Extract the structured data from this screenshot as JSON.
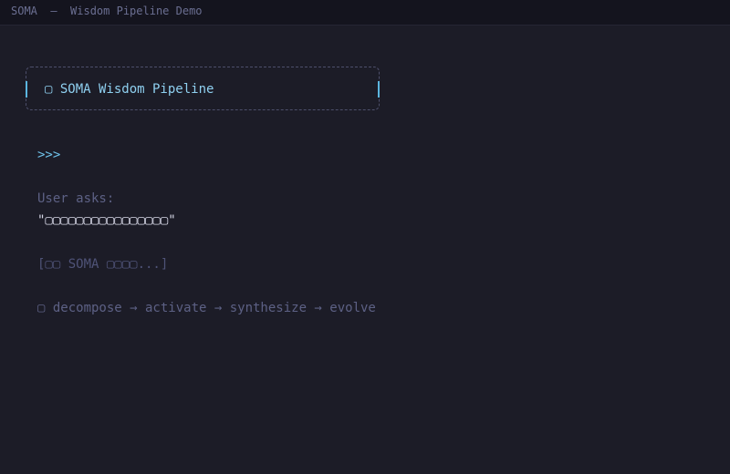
{
  "window": {
    "title": "SOMA  —  Wisdom Pipeline Demo"
  },
  "header": {
    "title": "▢ SOMA Wisdom Pipeline"
  },
  "terminal": {
    "prompt": ">>>",
    "user_asks_label": "User asks:",
    "user_query": "\"▢▢▢▢▢▢▢▢▢▢▢▢▢▢▢▢\"",
    "status": "[▢▢ SOMA ▢▢▢▢...]",
    "pipeline": "▢ decompose → activate → synthesize → evolve"
  }
}
